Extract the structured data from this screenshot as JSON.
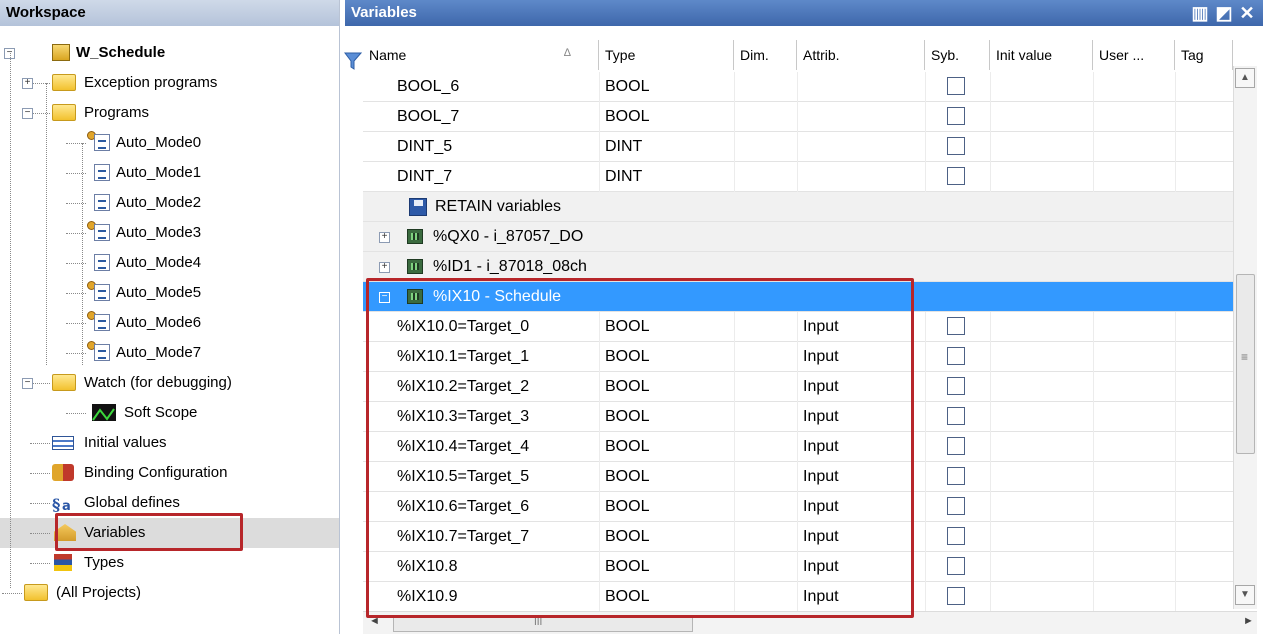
{
  "workspace": {
    "title": "Workspace",
    "tree": [
      {
        "label": "W_Schedule",
        "depth": 0,
        "icon": "project-icon",
        "expander": "−",
        "bold": true
      },
      {
        "label": "Exception programs",
        "depth": 1,
        "icon": "folder-icon",
        "expander": "+"
      },
      {
        "label": "Programs",
        "depth": 1,
        "icon": "folder-icon",
        "expander": "−"
      },
      {
        "label": "Auto_Mode0",
        "depth": 2,
        "icon": "program-key-icon"
      },
      {
        "label": "Auto_Mode1",
        "depth": 2,
        "icon": "program-icon"
      },
      {
        "label": "Auto_Mode2",
        "depth": 2,
        "icon": "program-icon"
      },
      {
        "label": "Auto_Mode3",
        "depth": 2,
        "icon": "program-key-icon"
      },
      {
        "label": "Auto_Mode4",
        "depth": 2,
        "icon": "program-icon"
      },
      {
        "label": "Auto_Mode5",
        "depth": 2,
        "icon": "program-key-icon"
      },
      {
        "label": "Auto_Mode6",
        "depth": 2,
        "icon": "program-key-icon"
      },
      {
        "label": "Auto_Mode7",
        "depth": 2,
        "icon": "program-key-icon"
      },
      {
        "label": "Watch (for debugging)",
        "depth": 1,
        "icon": "folder-icon",
        "expander": "−"
      },
      {
        "label": "Soft Scope",
        "depth": 2,
        "icon": "scope-icon"
      },
      {
        "label": "Initial values",
        "depth": 1,
        "icon": "initial-values-icon"
      },
      {
        "label": "Binding Configuration",
        "depth": 1,
        "icon": "binding-icon"
      },
      {
        "label": "Global defines",
        "depth": 1,
        "icon": "defines-icon"
      },
      {
        "label": "Variables",
        "depth": 1,
        "icon": "variables-icon",
        "selected": true
      },
      {
        "label": "Types",
        "depth": 1,
        "icon": "types-icon"
      },
      {
        "label": "(All Projects)",
        "depth": 0,
        "icon": "folder-icon"
      }
    ]
  },
  "variables_panel": {
    "title": "Variables",
    "window_buttons": [
      "▥",
      "◩",
      "✕"
    ],
    "columns": [
      "Name",
      "Type",
      "Dim.",
      "Attrib.",
      "Syb.",
      "Init value",
      "User ...",
      "Tag"
    ],
    "sort_indicator": "∆",
    "rows": [
      {
        "kind": "var",
        "name": "BOOL_6",
        "type": "BOOL",
        "attrib": ""
      },
      {
        "kind": "var",
        "name": "BOOL_7",
        "type": "BOOL",
        "attrib": ""
      },
      {
        "kind": "var",
        "name": "DINT_5",
        "type": "DINT",
        "attrib": ""
      },
      {
        "kind": "var",
        "name": "DINT_7",
        "type": "DINT",
        "attrib": ""
      },
      {
        "kind": "group",
        "name": "RETAIN variables",
        "icon": "save-icon"
      },
      {
        "kind": "group",
        "name": "%QX0 - i_87057_DO",
        "icon": "io-board-icon",
        "expander": "+"
      },
      {
        "kind": "group",
        "name": "%ID1 - i_87018_08ch",
        "icon": "io-board-icon",
        "expander": "+"
      },
      {
        "kind": "group",
        "name": "%IX10 - Schedule",
        "icon": "io-board-icon",
        "expander": "−",
        "selected": true
      },
      {
        "kind": "var",
        "name": "%IX10.0=Target_0",
        "type": "BOOL",
        "attrib": "Input"
      },
      {
        "kind": "var",
        "name": "%IX10.1=Target_1",
        "type": "BOOL",
        "attrib": "Input"
      },
      {
        "kind": "var",
        "name": "%IX10.2=Target_2",
        "type": "BOOL",
        "attrib": "Input"
      },
      {
        "kind": "var",
        "name": "%IX10.3=Target_3",
        "type": "BOOL",
        "attrib": "Input"
      },
      {
        "kind": "var",
        "name": "%IX10.4=Target_4",
        "type": "BOOL",
        "attrib": "Input"
      },
      {
        "kind": "var",
        "name": "%IX10.5=Target_5",
        "type": "BOOL",
        "attrib": "Input"
      },
      {
        "kind": "var",
        "name": "%IX10.6=Target_6",
        "type": "BOOL",
        "attrib": "Input"
      },
      {
        "kind": "var",
        "name": "%IX10.7=Target_7",
        "type": "BOOL",
        "attrib": "Input"
      },
      {
        "kind": "var",
        "name": "%IX10.8",
        "type": "BOOL",
        "attrib": "Input"
      },
      {
        "kind": "var",
        "name": "%IX10.9",
        "type": "BOOL",
        "attrib": "Input"
      }
    ],
    "scroll": {
      "up": "▲",
      "down": "▼",
      "grip": "≡",
      "left": "◄",
      "right": "►",
      "hgrip": "III"
    }
  },
  "colors": {
    "selection": "#3399ff",
    "highlight_box": "#b7262a",
    "title_bar": "#4a74b8"
  }
}
